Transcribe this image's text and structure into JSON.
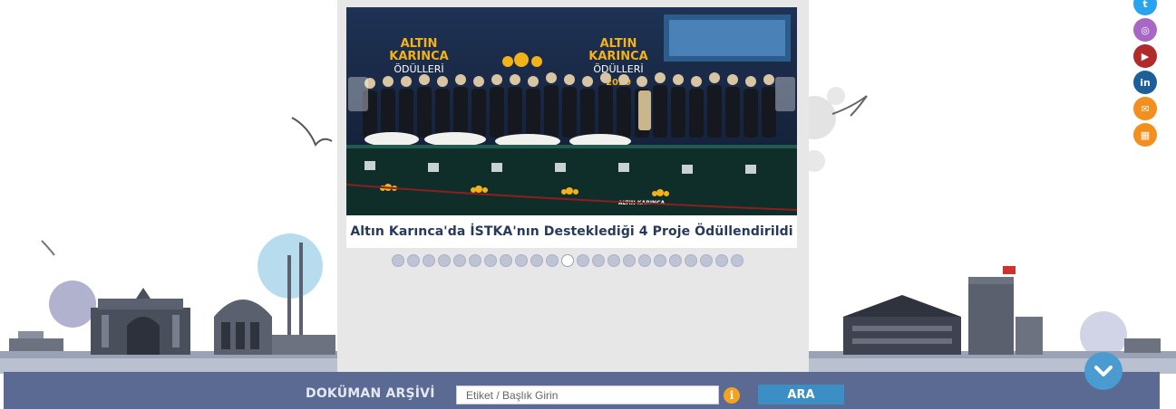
{
  "slider": {
    "caption": "Altın Karınca'da İSTKA'nın Desteklediği 4 Proje Ödüllendirildi",
    "dot_count": 23,
    "active_dot": 11,
    "image": {
      "sign_left": [
        "ALTIN",
        "KARINCA",
        "ÖDÜLLERİ"
      ],
      "sign_right": [
        "ALTIN",
        "KARINCA",
        "ÖDÜLLERİ"
      ],
      "year": "2020",
      "brand": "ALTIN KARINCA"
    }
  },
  "social": [
    {
      "name": "twitter-icon",
      "glyph": "t",
      "color": "#2aa3ef"
    },
    {
      "name": "instagram-icon",
      "glyph": "◎",
      "color": "#a767c4"
    },
    {
      "name": "youtube-icon",
      "glyph": "▶",
      "color": "#b02b2b"
    },
    {
      "name": "linkedin-icon",
      "glyph": "in",
      "color": "#1d5f9b"
    },
    {
      "name": "email-icon",
      "glyph": "✉",
      "color": "#f28f1e"
    },
    {
      "name": "kep-icon",
      "glyph": "▦",
      "color": "#f28f1e"
    }
  ],
  "footer": {
    "archive_label": "DOKÜMAN ARŞİVİ",
    "search_placeholder": "Etiket / Başlık Girin",
    "info_glyph": "i",
    "search_button": "ARA"
  },
  "colors": {
    "footer": "#5a6a92",
    "accent_blue": "#3b8fc4",
    "caption": "#263a5e"
  }
}
